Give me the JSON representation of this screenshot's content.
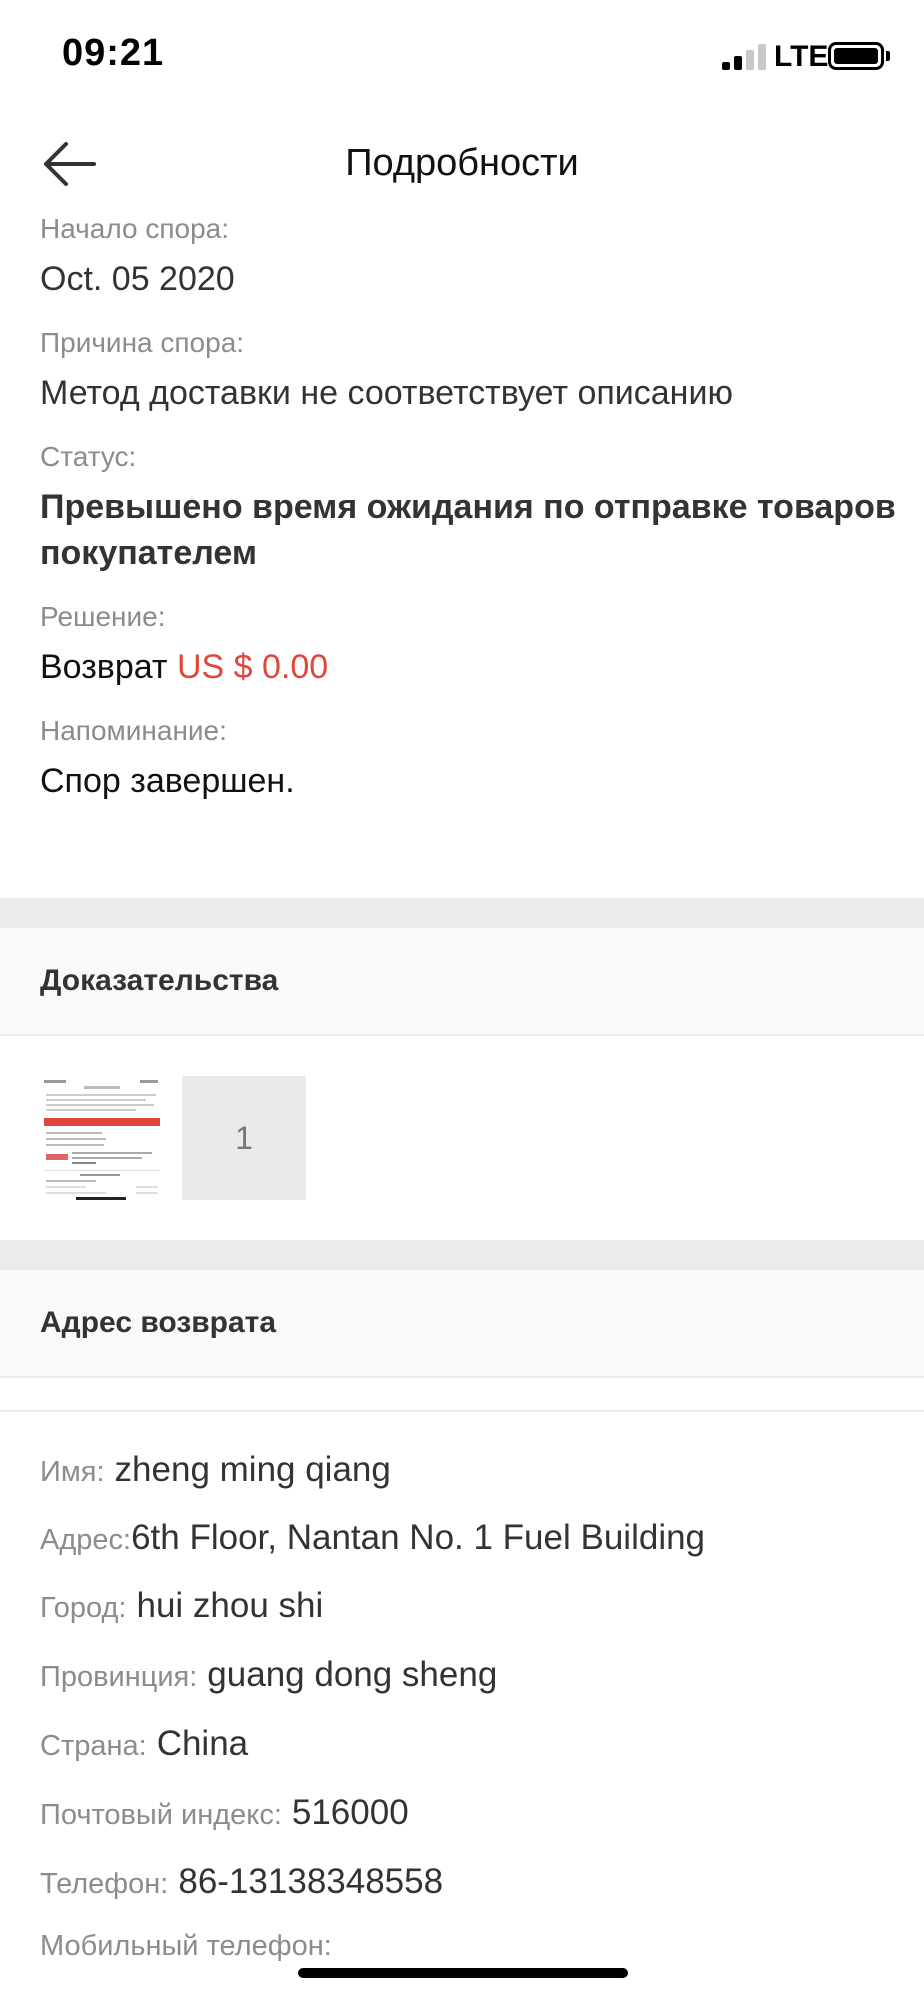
{
  "status_bar": {
    "time": "09:21",
    "network": "LTE"
  },
  "nav": {
    "title": "Подробности"
  },
  "details": {
    "start_label": "Начало спора:",
    "start_value": "Oct. 05 2020",
    "reason_label": "Причина спора:",
    "reason_value": "Метод доставки не соответствует описанию",
    "status_label": "Статус:",
    "status_value": "Превышено время ожидания по отправке товаров покупателем",
    "solution_label": "Решение:",
    "solution_prefix": "Возврат",
    "solution_amount": "US $ 0.00",
    "reminder_label": "Напоминание:",
    "reminder_value": "Спор завершен."
  },
  "evidence": {
    "heading": "Доказательства",
    "extra_count": "1"
  },
  "return_address": {
    "heading": "Адрес возврата",
    "name_label": "Имя:",
    "name_value": "zheng ming qiang",
    "address_label": "Адрес:",
    "address_value": "6th Floor, Nantan No. 1 Fuel Building",
    "city_label": "Город:",
    "city_value": "hui zhou shi",
    "province_label": "Провинция:",
    "province_value": "guang dong sheng",
    "country_label": "Страна:",
    "country_value": "China",
    "zip_label": "Почтовый индекс:",
    "zip_value": "516000",
    "phone_label": "Телефон:",
    "phone_value": "86-13138348558",
    "mobile_label": "Мобильный телефон:"
  },
  "colors": {
    "accent_red": "#e0463a",
    "muted": "#8c8c8c",
    "divider": "#ebebeb"
  }
}
